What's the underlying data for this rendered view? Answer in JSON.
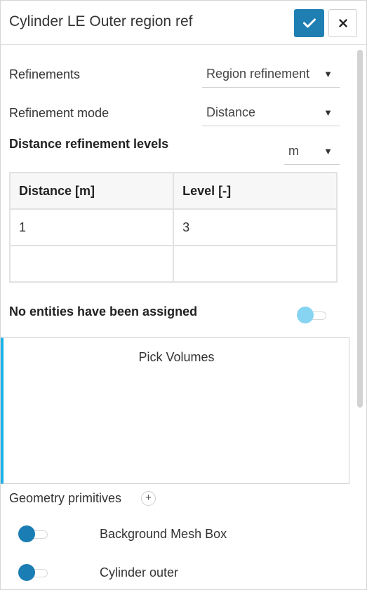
{
  "header": {
    "title": "Cylinder LE Outer region ref",
    "confirm_icon": "check-icon",
    "close_icon": "close-icon",
    "confirm_color": "#1f7fb2"
  },
  "refinements": {
    "label": "Refinements",
    "value": "Region refinement"
  },
  "refinement_mode": {
    "label": "Refinement mode",
    "value": "Distance"
  },
  "distance_levels": {
    "title": "Distance refinement levels",
    "unit": "m",
    "columns": [
      "Distance [m]",
      "Level [-]"
    ],
    "rows": [
      [
        "1",
        "3"
      ],
      [
        "",
        ""
      ]
    ]
  },
  "assignment": {
    "message": "No entities have been assigned",
    "toggle_on": false,
    "toggle_color": "#87d3f2"
  },
  "pick": {
    "label": "Pick Volumes",
    "accent_color": "#1ab0e8"
  },
  "geometry": {
    "label": "Geometry primitives",
    "add_icon": "plus-icon",
    "items": [
      {
        "label": "Background Mesh Box",
        "toggle_on": false
      },
      {
        "label": "Cylinder outer",
        "toggle_on": false
      }
    ],
    "toggle_color": "#1a7db3"
  }
}
